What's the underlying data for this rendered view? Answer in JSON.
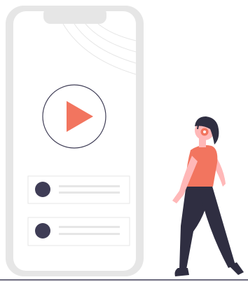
{
  "illustration": {
    "subject": "person-with-headphones-beside-phone-music-player",
    "icons": {
      "play": "play-icon",
      "signal": "wifi-arcs-icon",
      "headphones": "headphones-icon"
    },
    "colors": {
      "phone_frame": "#e6e6e6",
      "screen": "#ffffff",
      "play_accent": "#f2755f",
      "outline": "#3f3d56",
      "track_dot": "#3f3d56",
      "track_line": "#e6e6e6",
      "skin": "#ffb8b8",
      "hair": "#2f2e41",
      "pants": "#2f2e41",
      "ground": "#3f3d56"
    },
    "playlist": [
      {
        "name": "track-1",
        "lines": 2
      },
      {
        "name": "track-2",
        "lines": 2
      }
    ]
  }
}
